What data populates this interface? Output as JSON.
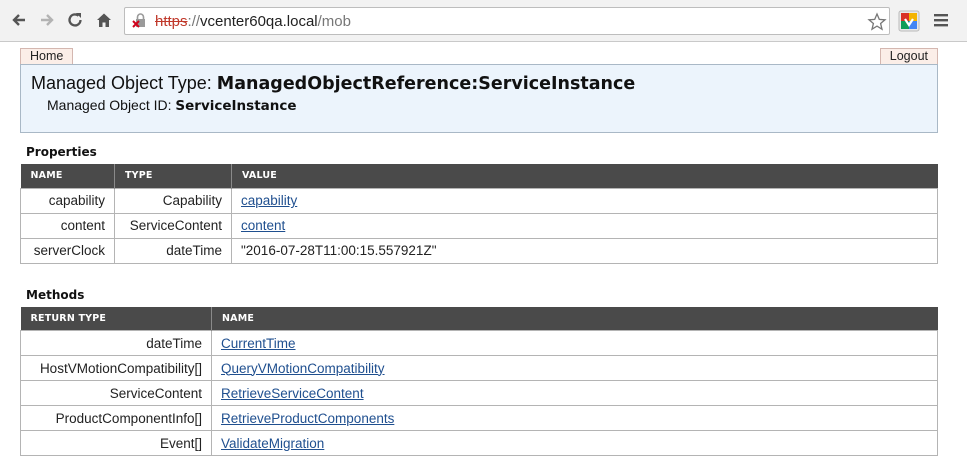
{
  "browser": {
    "url_scheme": "https",
    "url_separator": "://",
    "url_host": "vcenter60qa.local",
    "url_path": "/mob"
  },
  "nav": {
    "home_label": "Home",
    "logout_label": "Logout"
  },
  "header": {
    "type_label": "Managed Object Type: ",
    "type_value": "ManagedObjectReference:ServiceInstance",
    "id_label": "Managed Object ID: ",
    "id_value": "ServiceInstance"
  },
  "properties": {
    "title": "Properties",
    "columns": [
      "NAME",
      "TYPE",
      "VALUE"
    ],
    "rows": [
      {
        "name": "capability",
        "type": "Capability",
        "value": "capability"
      },
      {
        "name": "content",
        "type": "ServiceContent",
        "value": "content"
      },
      {
        "name": "serverClock",
        "type": "dateTime",
        "value": "\"2016-07-28T11:00:15.557921Z\""
      }
    ]
  },
  "methods": {
    "title": "Methods",
    "columns": [
      "RETURN TYPE",
      "NAME"
    ],
    "rows": [
      {
        "return_type": "dateTime",
        "name": "CurrentTime"
      },
      {
        "return_type": "HostVMotionCompatibility[]",
        "name": "QueryVMotionCompatibility"
      },
      {
        "return_type": "ServiceContent",
        "name": "RetrieveServiceContent"
      },
      {
        "return_type": "ProductComponentInfo[]",
        "name": "RetrieveProductComponents"
      },
      {
        "return_type": "Event[]",
        "name": "ValidateMigration"
      }
    ]
  }
}
